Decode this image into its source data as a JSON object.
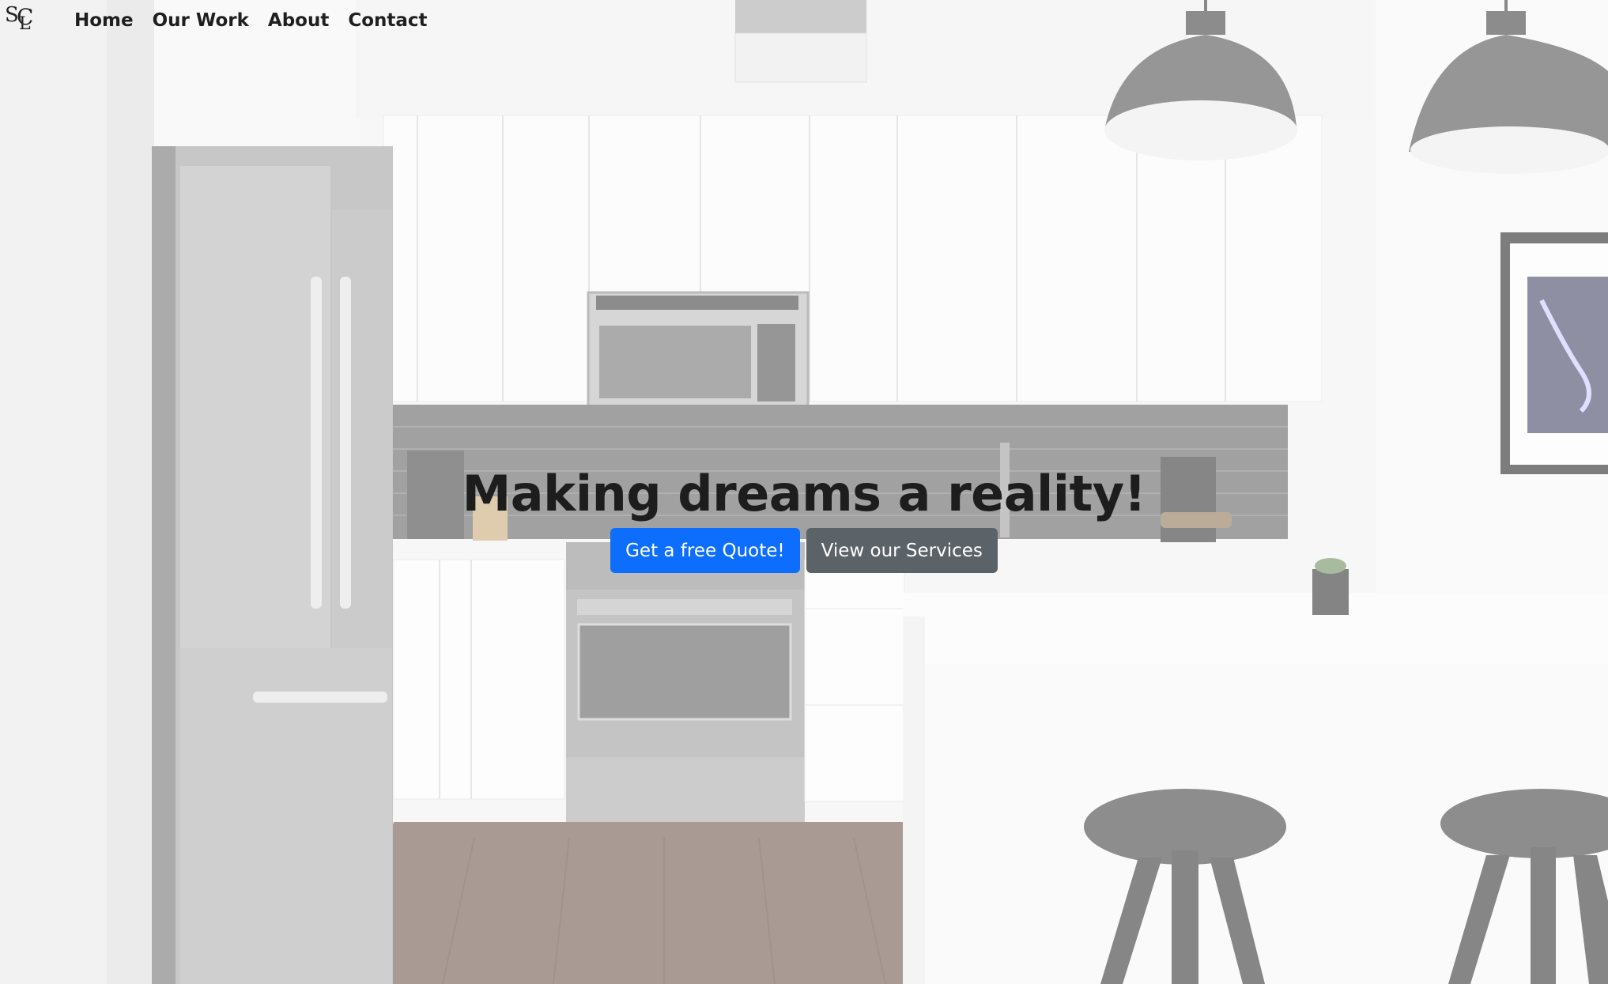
{
  "brand": {
    "initials_s": "S",
    "initials_c": "C",
    "initials_l": "L"
  },
  "nav": {
    "items": [
      {
        "label": "Home"
      },
      {
        "label": "Our Work"
      },
      {
        "label": "About"
      },
      {
        "label": "Contact"
      }
    ]
  },
  "hero": {
    "headline": "Making dreams a reality!",
    "primary_button": "Get a free Quote!",
    "secondary_button": "View our Services"
  },
  "colors": {
    "primary": "#0d6efd",
    "secondary": "#5b6268",
    "text": "#1d1d1d"
  }
}
